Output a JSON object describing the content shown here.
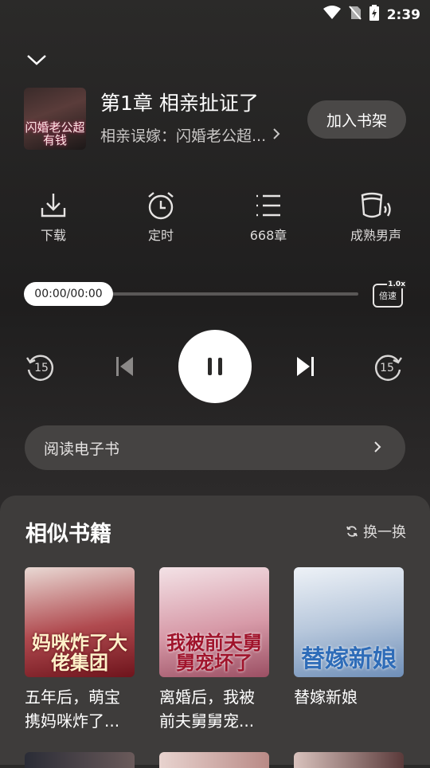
{
  "status": {
    "time": "2:39"
  },
  "header": {
    "cover_text": "闪婚老公超有钱",
    "chapter_title": "第1章 相亲扯证了",
    "book_title": "相亲误嫁：闪婚老公超...",
    "shelf_button": "加入书架"
  },
  "tools": [
    {
      "label": "下载",
      "icon": "download-icon"
    },
    {
      "label": "定时",
      "icon": "alarm-clock-icon"
    },
    {
      "label": "668章",
      "icon": "chapter-list-icon"
    },
    {
      "label": "成熟男声",
      "icon": "voice-icon"
    }
  ],
  "progress": {
    "time": "00:00/00:00",
    "fraction": 0
  },
  "speed": {
    "label": "倍速",
    "value": "1.0x"
  },
  "controls": {
    "rewind": "15",
    "forward": "15"
  },
  "read_ebook": "阅读电子书",
  "similar": {
    "title": "相似书籍",
    "refresh_label": "换一换",
    "books": [
      {
        "name": "五年后，萌宝携妈咪炸了...",
        "cover_text": "妈咪炸了大佬集团",
        "color": "#8a1f2a"
      },
      {
        "name": "离婚后，我被前夫舅舅宠...",
        "cover_text": "我被前夫舅舅宠坏了",
        "color": "#c98a9a"
      },
      {
        "name": "替嫁新娘",
        "cover_text": "替嫁新娘",
        "color": "#9fb3cc"
      }
    ]
  },
  "colors": {
    "background": "#2b2a29",
    "panel": "#3e3c3b",
    "pill": "#4a4847"
  }
}
